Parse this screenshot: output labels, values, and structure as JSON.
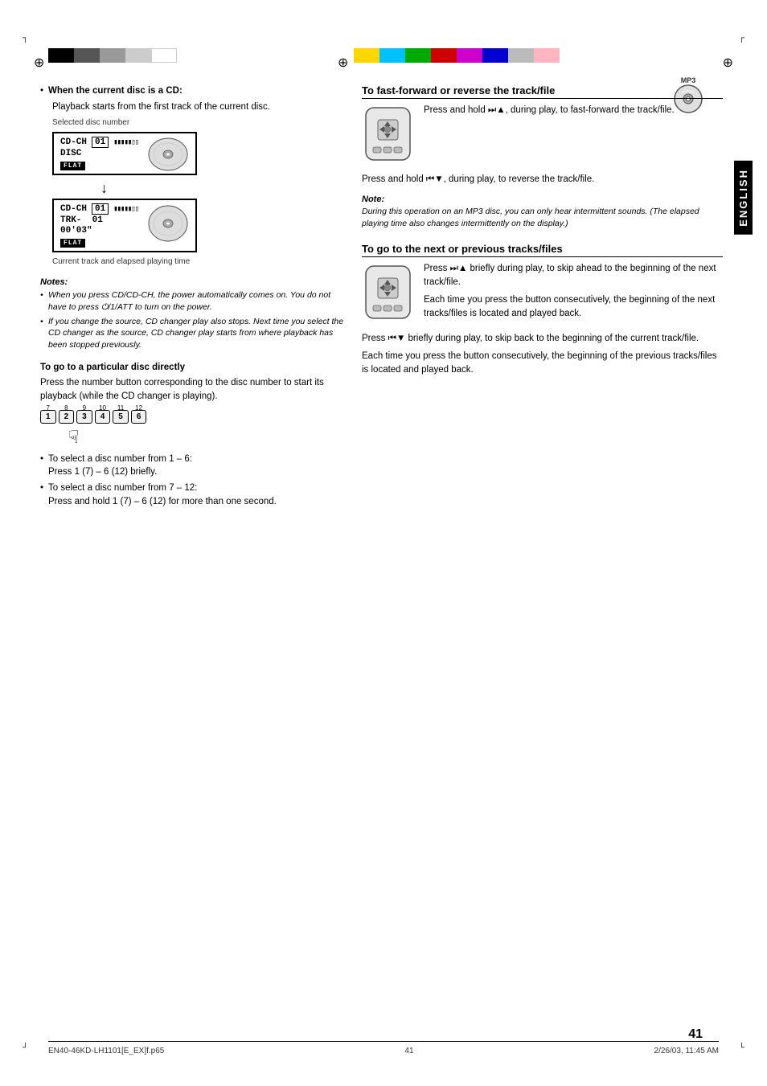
{
  "page": {
    "number": "41",
    "language_label": "ENGLISH",
    "footer_left": "EN40-46KD-LH1101[E_EX]f.p65",
    "footer_center": "41",
    "footer_right": "2/26/03, 11:45 AM"
  },
  "mp3": {
    "label": "MP3"
  },
  "left_col": {
    "cd_section": {
      "bullet": "When the current disc is a CD:",
      "body": "Playback starts from the first track of the current disc.",
      "caption_top": "Selected disc number",
      "caption_bottom": "Current track and elapsed playing time"
    },
    "notes": {
      "heading": "Notes:",
      "items": [
        "When you press CD/CD-CH, the power automatically comes on. You do not have to press ⏻/1/ATT to turn on the power.",
        "If you change the source, CD changer play also stops. Next time you select the CD changer as the source, CD changer play starts from where playback has been stopped previously."
      ]
    },
    "particular_disc": {
      "heading": "To go to a particular disc directly",
      "body": "Press the number button corresponding to the disc number to start its playback (while the CD changer is playing).",
      "bullets": [
        {
          "text": "To select a disc number from 1 – 6: Press 1 (7) – 6 (12) briefly."
        },
        {
          "text": "To select a disc number from 7 – 12: Press and hold 1 (7) – 6 (12) for more than one second."
        }
      ],
      "buttons": [
        "1",
        "2",
        "3",
        "4",
        "5",
        "6"
      ],
      "button_superscripts": [
        "7",
        "8",
        "9",
        "10",
        "11",
        "12"
      ]
    }
  },
  "right_col": {
    "fast_forward": {
      "heading": "To fast-forward or reverse the track/file",
      "line1": "Press and hold ▶▶| ▲, during play, to fast-forward the track/file.",
      "line2": "Press and hold |◀◀ ▼, during play, to reverse the track/file.",
      "note_heading": "Note:",
      "note_text": "During this operation on an MP3 disc, you can only hear intermittent sounds. (The elapsed playing time also changes intermittently on the display.)"
    },
    "next_prev": {
      "heading": "To go to the next or previous tracks/files",
      "line1": "Press ▶▶| ▲ briefly during play, to skip ahead to the beginning of the next track/file.",
      "line2": "Each time you press the button consecutively, the beginning of the next tracks/files is located and played back.",
      "line3": "Press |◀◀ ▼ briefly during play, to skip back to the beginning of the current track/file.",
      "line4": "Each time you press the button consecutively, the beginning of the previous tracks/files is located and played back."
    }
  },
  "display1": {
    "line1": "CD-CH  01",
    "line2": "DISC",
    "flat": "FLAT"
  },
  "display2": {
    "line1": "CD-CH  01",
    "line2": "TRK-  01",
    "line3": "00'03\"",
    "flat": "FLAT"
  }
}
